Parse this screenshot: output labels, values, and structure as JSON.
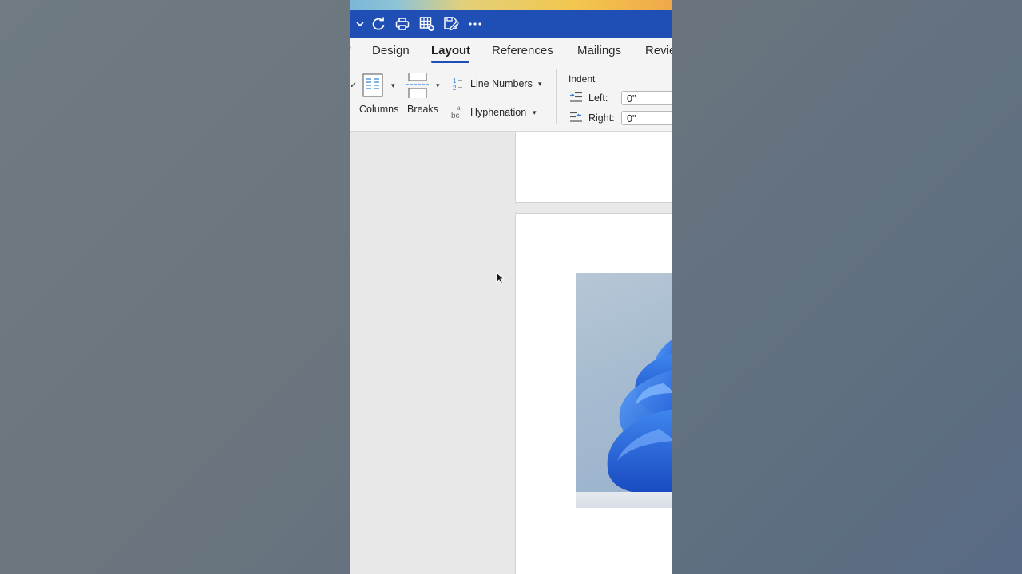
{
  "toolbar": {
    "icons": [
      "chevron-down-icon",
      "redo-icon",
      "print-icon",
      "insert-table-icon",
      "save-edit-icon",
      "more-icon"
    ]
  },
  "tabs": [
    {
      "label": "Design"
    },
    {
      "label": "Layout",
      "active": true
    },
    {
      "label": "References"
    },
    {
      "label": "Mailings"
    },
    {
      "label": "Revie"
    }
  ],
  "ribbon": {
    "columns_label": "Columns",
    "breaks_label": "Breaks",
    "line_numbers_label": "Line Numbers",
    "hyphenation_label": "Hyphenation",
    "indent_header": "Indent",
    "indent_left_label": "Left:",
    "indent_left_value": "0\"",
    "indent_right_label": "Right:",
    "indent_right_value": "0\""
  },
  "colors": {
    "titlebar": "#1f4fb5",
    "accent": "#1f4fb5",
    "picture_blue": "#2f6de0"
  }
}
